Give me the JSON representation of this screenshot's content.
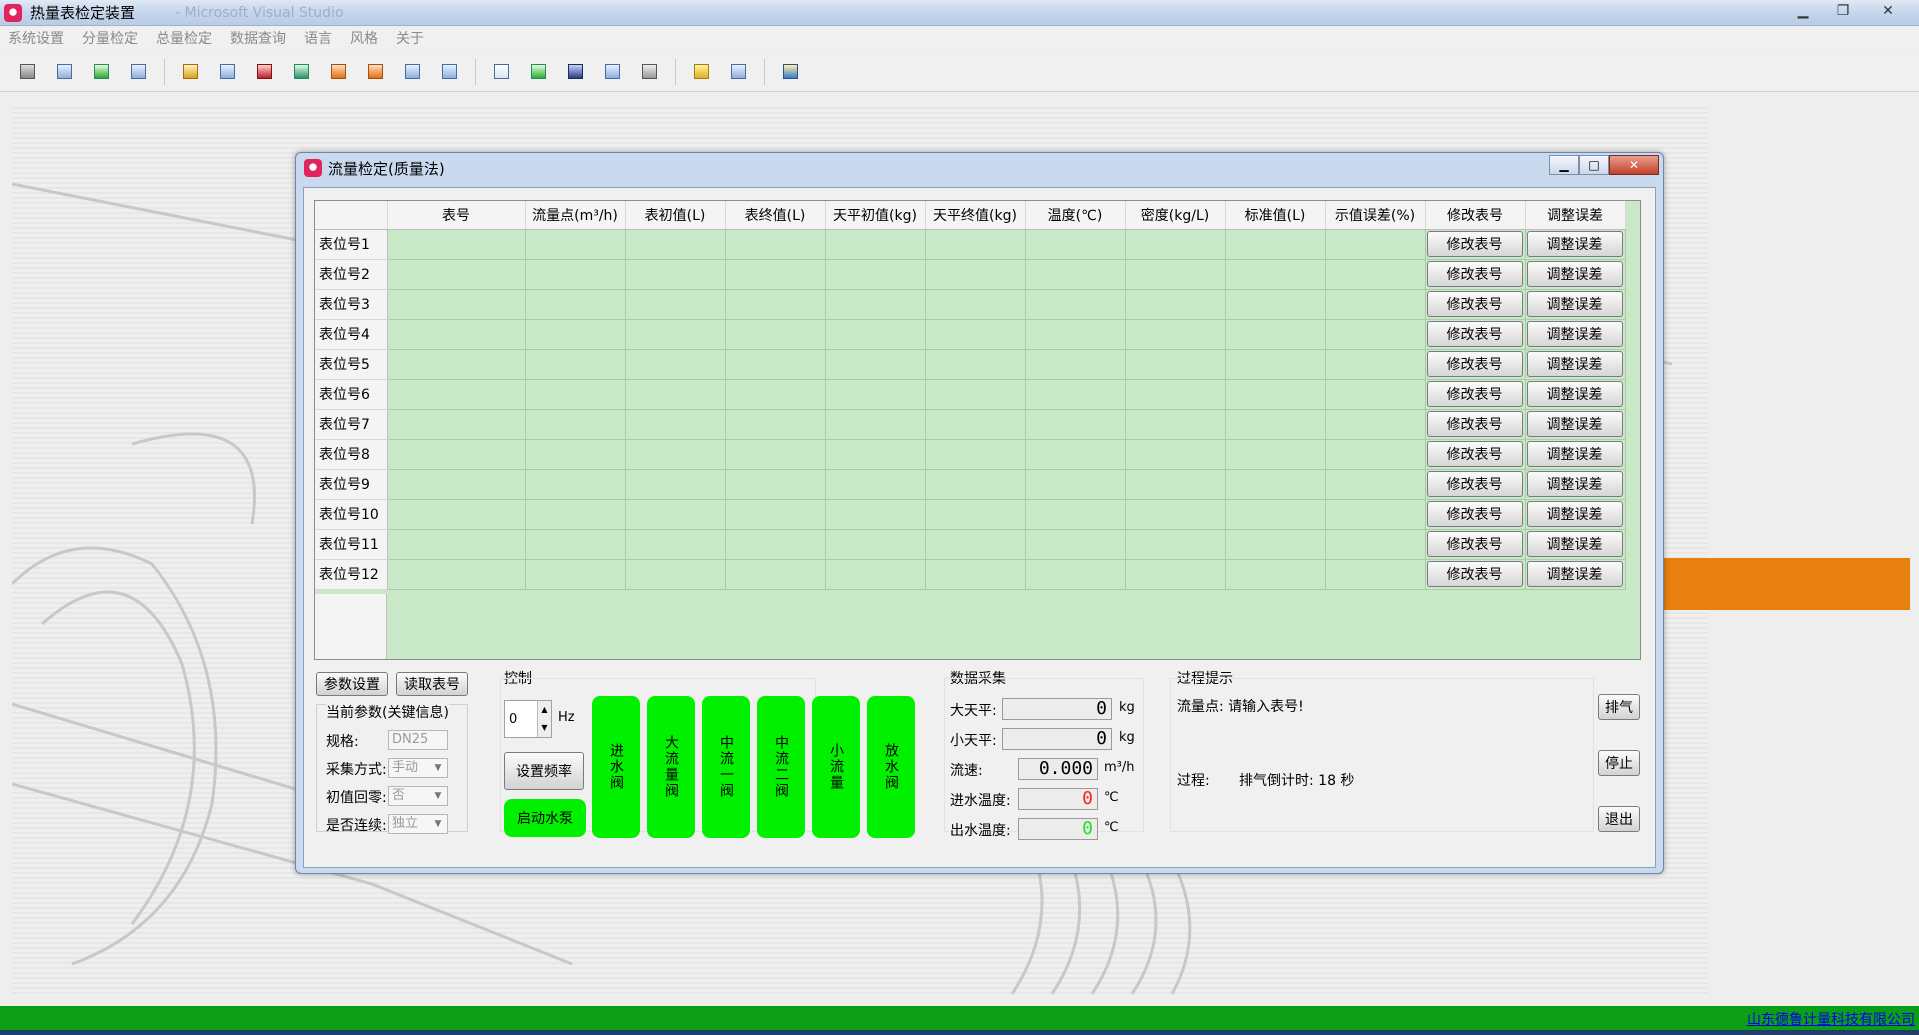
{
  "app": {
    "title": "热量表检定装置",
    "ghost_title": "- Microsoft Visual Studio",
    "win_min": "▁",
    "win_max": "❐",
    "win_close": "✕"
  },
  "menu": [
    "系统设置",
    "分量检定",
    "总量检定",
    "数据查询",
    "语言",
    "风格",
    "关于"
  ],
  "toolbar_icons": [
    "tools-icon",
    "grid-icon",
    "flow-icon",
    "chart-icon",
    "db-icon",
    "table-icon",
    "record-icon",
    "list-icon",
    "export-icon",
    "import-icon",
    "doc-icon",
    "doc2-icon",
    "page-icon",
    "up-arrow-icon",
    "save-icon",
    "edit-icon",
    "print-icon",
    "folder-icon",
    "image-icon",
    "exit-icon"
  ],
  "status": {
    "company": "山东德鲁计量科技有限公司"
  },
  "dialog": {
    "title": "流量检定(质量法)",
    "min": "▁",
    "max": "□",
    "close": "✕",
    "columns": [
      "表号",
      "流量点(m³/h)",
      "表初值(L)",
      "表终值(L)",
      "天平初值(kg)",
      "天平终值(kg)",
      "温度(℃)",
      "密度(kg/L)",
      "标准值(L)",
      "示值误差(%)",
      "修改表号",
      "调整误差"
    ],
    "rows": [
      "表位号1",
      "表位号2",
      "表位号3",
      "表位号4",
      "表位号5",
      "表位号6",
      "表位号7",
      "表位号8",
      "表位号9",
      "表位号10",
      "表位号11",
      "表位号12"
    ],
    "modify_btn": "修改表号",
    "adjust_btn": "调整误差",
    "params": {
      "set_btn": "参数设置",
      "read_btn": "读取表号",
      "group_title": "当前参数(关键信息)",
      "spec_label": "规格:",
      "spec_value": "DN25",
      "mode_label": "采集方式:",
      "mode_value": "手动",
      "zero_label": "初值回零:",
      "zero_value": "否",
      "cont_label": "是否连续:",
      "cont_value": "独立"
    },
    "control": {
      "title": "控制",
      "freq_value": "0",
      "freq_unit": "Hz",
      "set_freq_btn": "设置频率",
      "start_pump_btn": "启动水泵",
      "valves": [
        "进水阀",
        "大流量阀",
        "中流一阀",
        "中流二阀",
        "小流量",
        "放水阀"
      ]
    },
    "acquisition": {
      "title": "数据采集",
      "big_balance_label": "大天平:",
      "big_balance_value": "0",
      "big_balance_unit": "kg",
      "small_balance_label": "小天平:",
      "small_balance_value": "0",
      "small_balance_unit": "kg",
      "flow_label": "流速:",
      "flow_value": "0.000",
      "flow_unit": "m³/h",
      "inlet_temp_label": "进水温度:",
      "inlet_temp_value": "0",
      "inlet_temp_unit": "℃",
      "outlet_temp_label": "出水温度:",
      "outlet_temp_value": "0",
      "outlet_temp_unit": "℃"
    },
    "process": {
      "title": "过程提示",
      "flow_point_text": "流量点: 请输入表号!",
      "process_label": "过程:",
      "process_text": "排气倒计时: 18 秒"
    },
    "side_buttons": {
      "vent": "排气",
      "stop": "停止",
      "exit": "退出"
    }
  }
}
